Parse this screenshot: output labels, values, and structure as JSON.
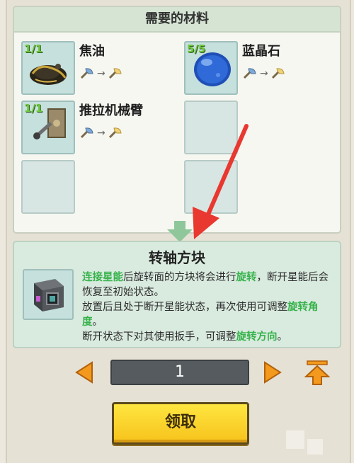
{
  "materials": {
    "header": "需要的材料",
    "items": [
      {
        "name": "焦油",
        "count": "1/1",
        "icon": "tar-icon"
      },
      {
        "name": "蓝晶石",
        "count": "5/5",
        "icon": "blue-crystal-icon"
      },
      {
        "name": "推拉机械臂",
        "count": "1/1",
        "icon": "mechanical-arm-icon"
      }
    ]
  },
  "item": {
    "title": "转轴方块",
    "icon": "rotation-block-icon",
    "desc_line1_hl": "连接星能",
    "desc_line1_mid": "后旋转面的方块将会进行",
    "desc_line1_hl2": "旋转",
    "desc_line1_end": "，断开星能后会恢复至初始状态。",
    "desc_line2": "放置后且处于断开星能状态，再次使用可调整",
    "desc_line2_hl": "旋转角度",
    "desc_line2_end": "。",
    "desc_line3": "断开状态下对其使用扳手，可调整",
    "desc_line3_hl": "旋转方向",
    "desc_line3_end": "。"
  },
  "quantity": {
    "value": "1"
  },
  "claim_button": {
    "label": "领取"
  },
  "colors": {
    "highlight": "#36b34a",
    "count": "#6ec63a",
    "button": "#f6c21b",
    "arrow": "#e8382f"
  }
}
